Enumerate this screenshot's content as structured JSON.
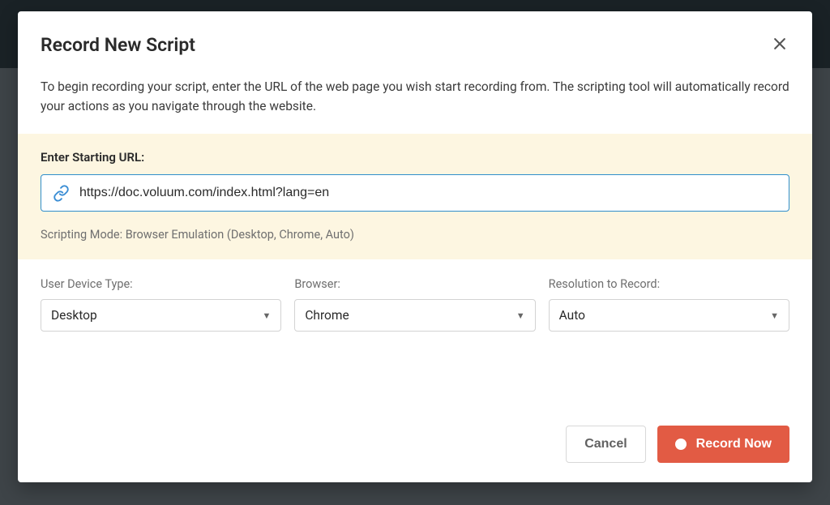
{
  "modal": {
    "title": "Record New Script",
    "description": "To begin recording your script, enter the URL of the web page you wish start recording from. The scripting tool will automatically record your actions as you navigate through the website.",
    "url_section": {
      "label": "Enter Starting URL:",
      "value": "https://doc.voluum.com/index.html?lang=en",
      "scripting_mode": "Scripting Mode: Browser Emulation (Desktop, Chrome, Auto)"
    },
    "selects": {
      "device": {
        "label": "User Device Type:",
        "value": "Desktop"
      },
      "browser": {
        "label": "Browser:",
        "value": "Chrome"
      },
      "resolution": {
        "label": "Resolution to Record:",
        "value": "Auto"
      }
    },
    "footer": {
      "cancel_label": "Cancel",
      "record_label": "Record Now"
    }
  }
}
